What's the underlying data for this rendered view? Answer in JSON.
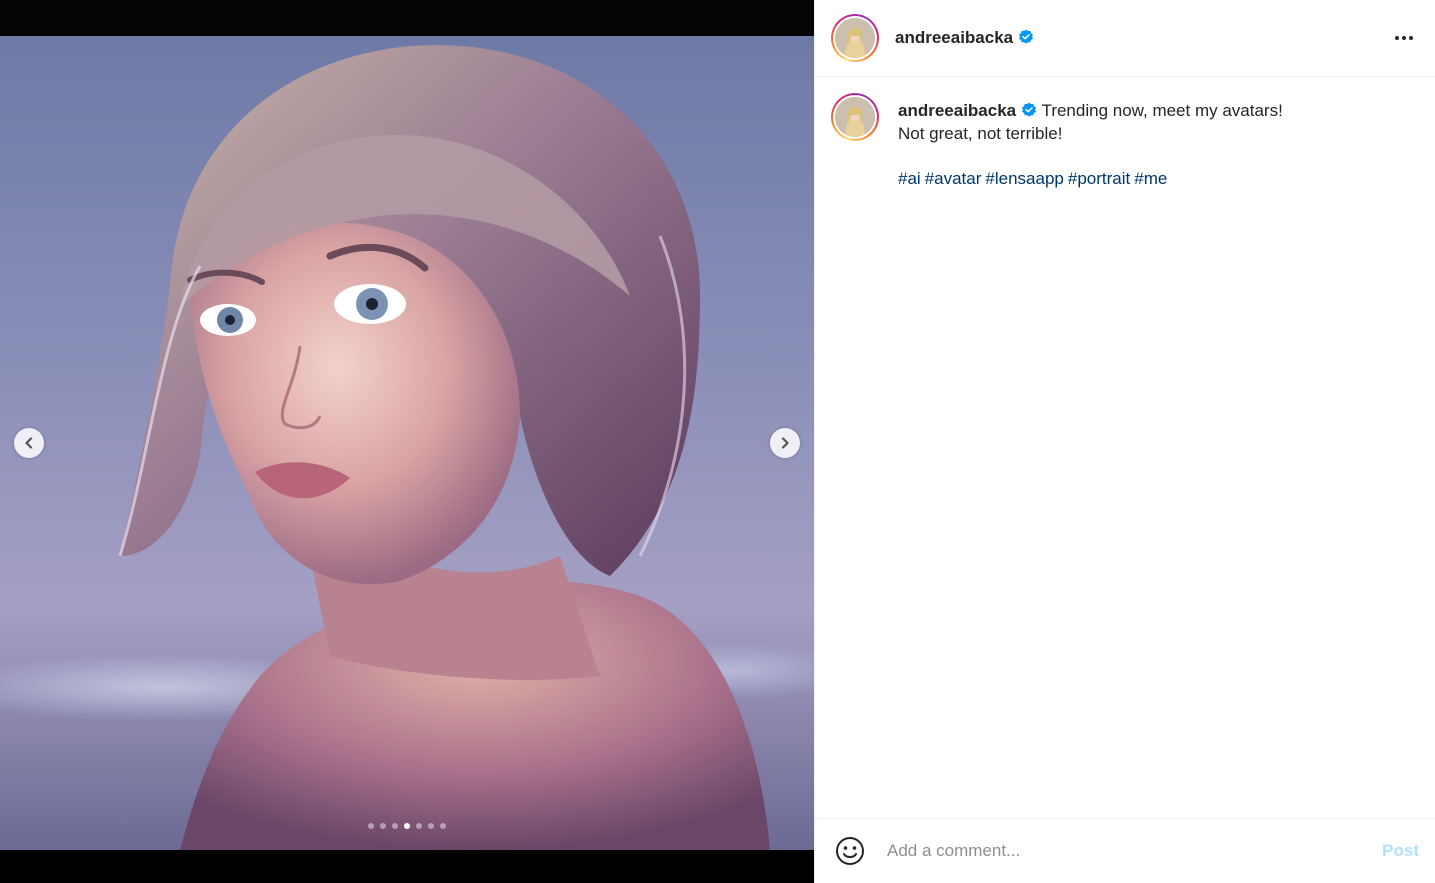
{
  "post": {
    "username": "andreeaibacka",
    "verified": true,
    "caption_line1": "Trending now, meet my avatars!",
    "caption_line2": "Not great, not terrible!",
    "hashtags": [
      "#ai",
      "#avatar",
      "#lensaapp",
      "#portrait",
      "#me"
    ]
  },
  "carousel": {
    "slide_count": 7,
    "active_index": 3
  },
  "comment": {
    "placeholder": "Add a comment...",
    "post_label": "Post"
  },
  "colors": {
    "hashtag": "#00376b",
    "verified_badge": "#0095f6",
    "post_button_disabled": "#b2dffc"
  },
  "icons": {
    "prev": "chevron-left-icon",
    "next": "chevron-right-icon",
    "more": "more-horizontal-icon",
    "emoji": "smiley-icon",
    "verified": "verified-badge-icon"
  }
}
